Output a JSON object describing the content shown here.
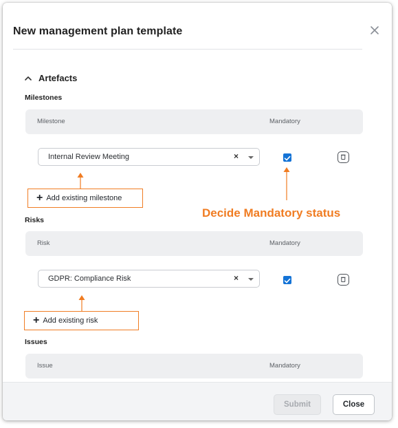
{
  "dialog": {
    "title": "New management plan template",
    "section": {
      "label": "Artefacts",
      "expanded": true
    }
  },
  "milestones": {
    "label": "Milestones",
    "columns": [
      "Milestone",
      "Mandatory"
    ],
    "rows": [
      {
        "value": "Internal Review Meeting",
        "clear": "×",
        "mandatory": true
      }
    ],
    "add_label": "Add existing milestone"
  },
  "risks": {
    "label": "Risks",
    "columns": [
      "Risk",
      "Mandatory"
    ],
    "rows": [
      {
        "value": "GDPR: Compliance Risk",
        "clear": "×",
        "mandatory": true
      }
    ],
    "add_label": "Add existing risk"
  },
  "issues": {
    "label": "Issues",
    "columns": [
      "Issue",
      "Mandatory"
    ]
  },
  "annotation": {
    "text": "Decide Mandatory status",
    "color": "#f07c22"
  },
  "footer": {
    "submit_label": "Submit",
    "close_label": "Close"
  },
  "colors": {
    "accent": "#1473d6",
    "highlight": "#f07c22"
  }
}
